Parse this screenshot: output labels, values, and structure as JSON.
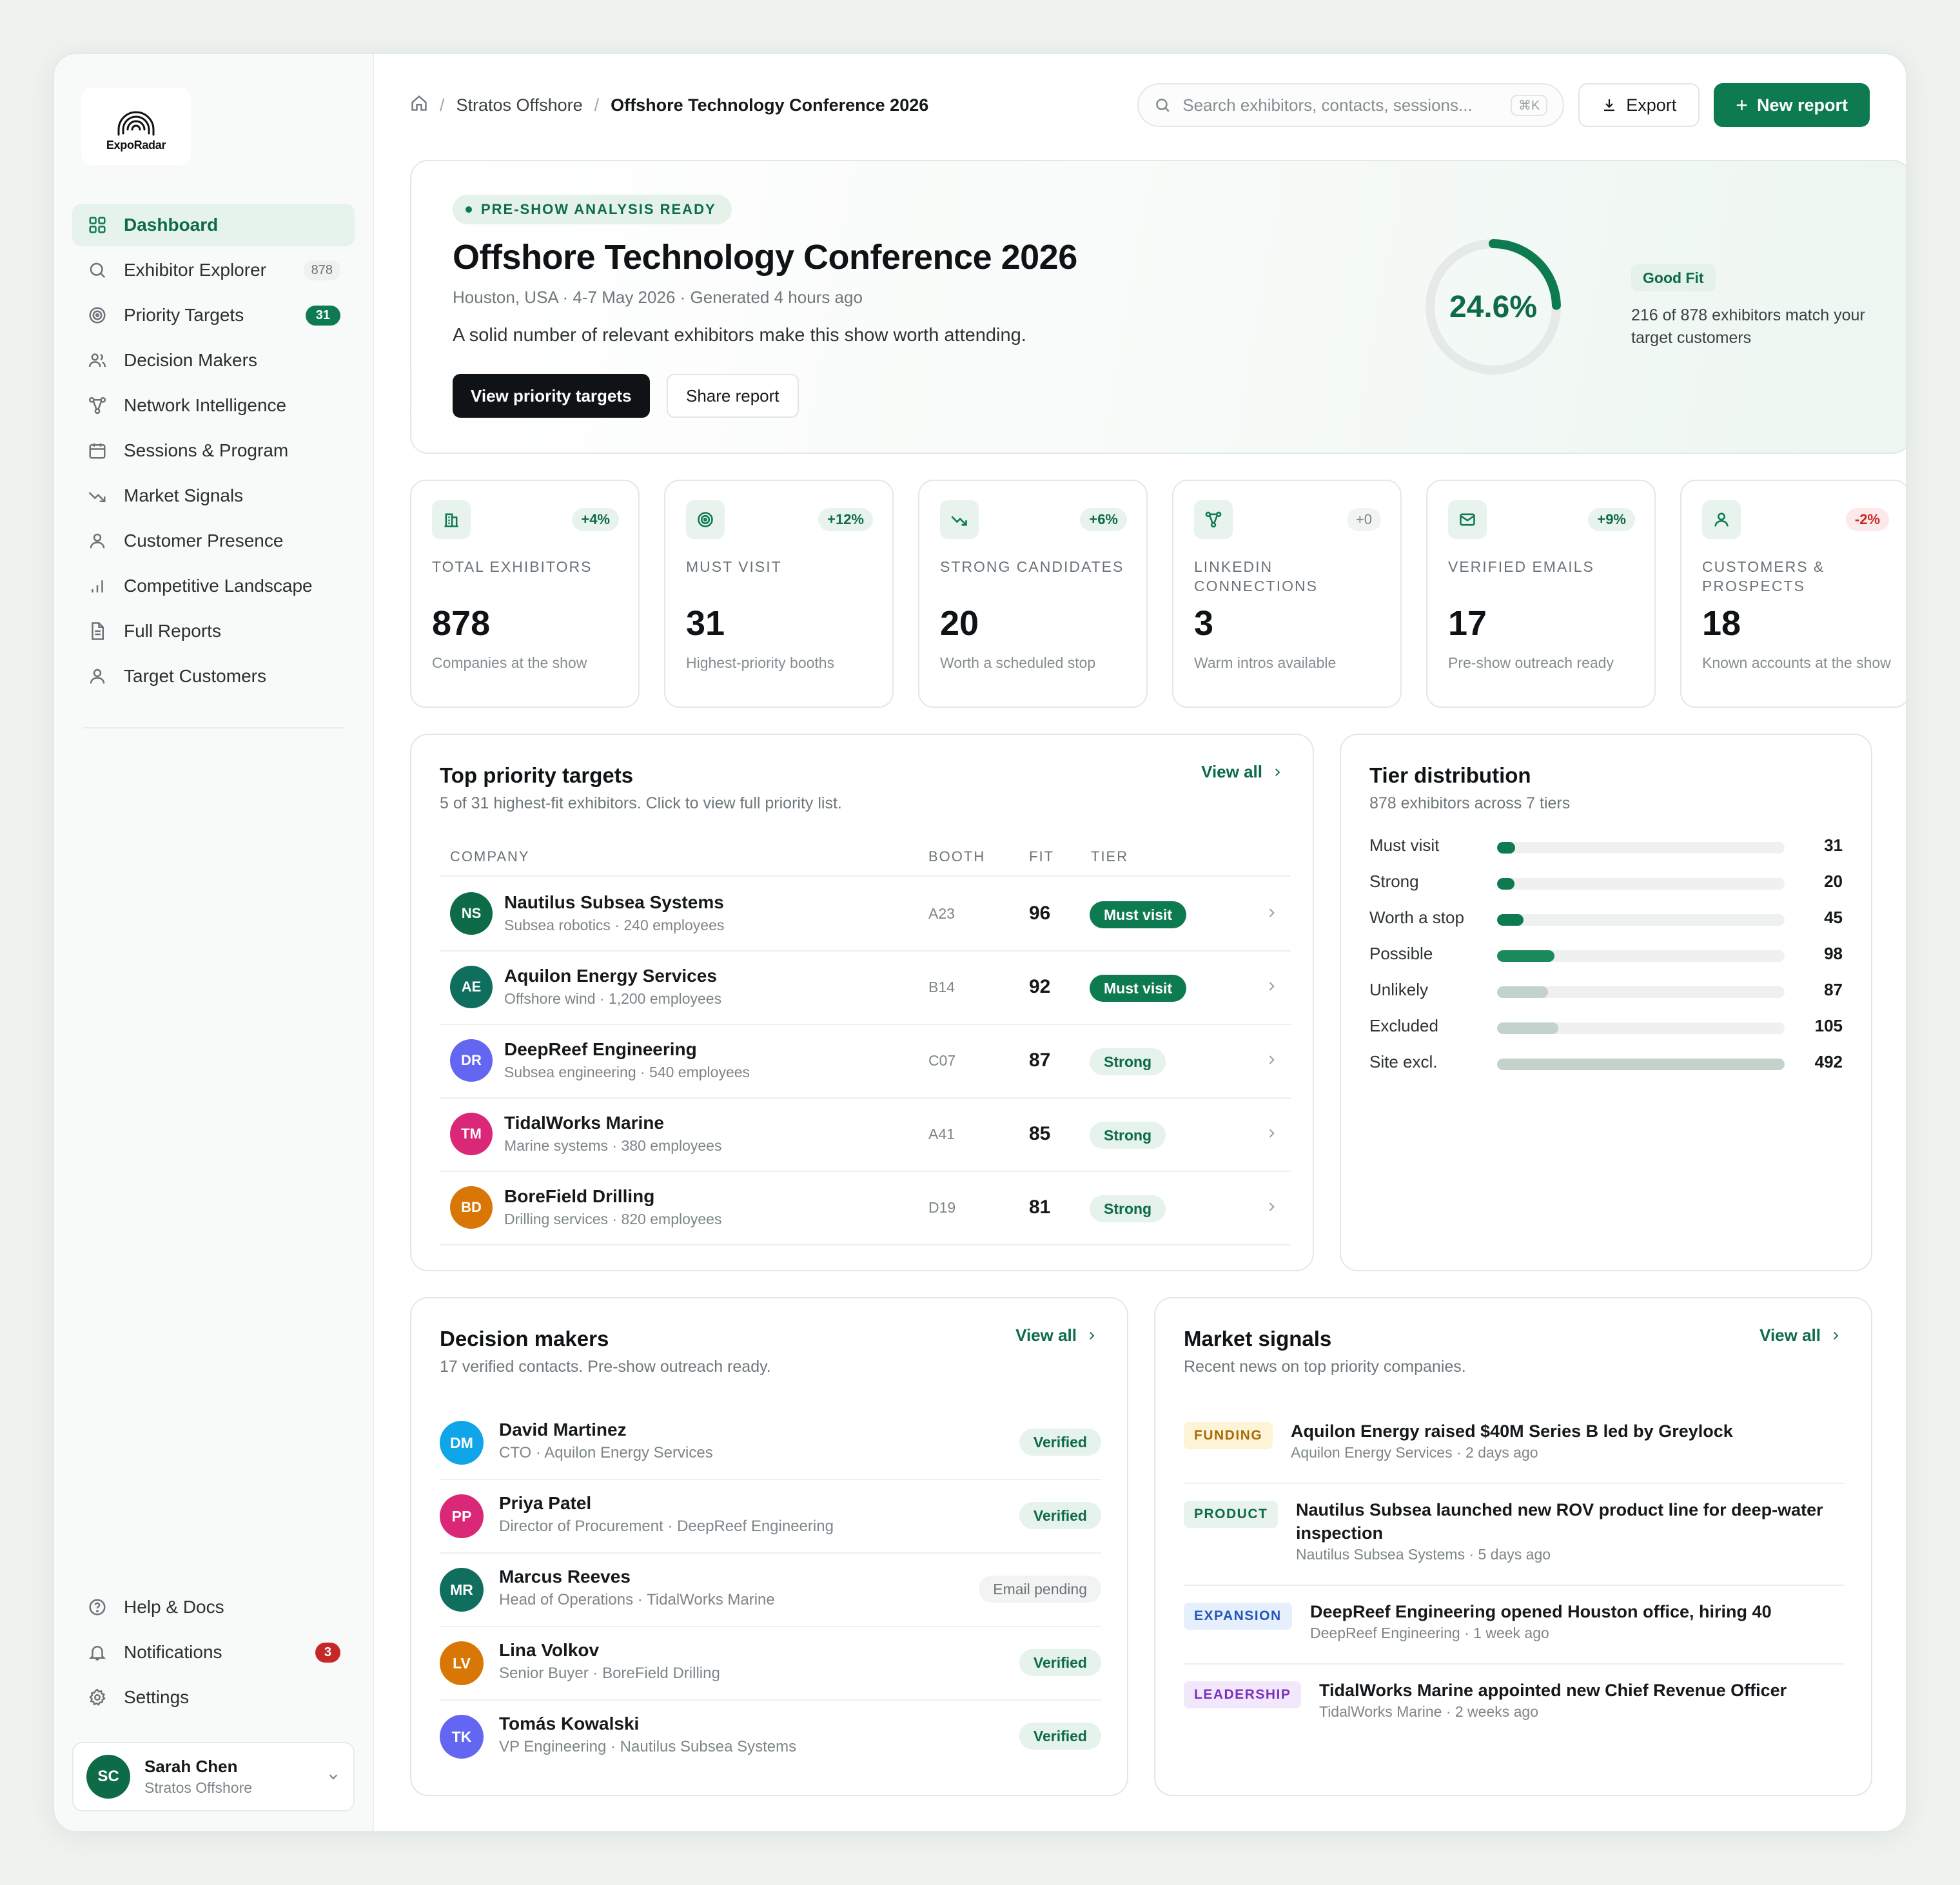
{
  "brand": {
    "name": "ExpoRadar"
  },
  "sidebar": {
    "items": [
      {
        "label": "Dashboard",
        "icon": "grid-icon",
        "active": true
      },
      {
        "label": "Exhibitor Explorer",
        "icon": "search-icon",
        "badge": "878"
      },
      {
        "label": "Priority Targets",
        "icon": "target-icon",
        "badge": "31"
      },
      {
        "label": "Decision Makers",
        "icon": "users-icon"
      },
      {
        "label": "Network Intelligence",
        "icon": "network-icon"
      },
      {
        "label": "Sessions & Program",
        "icon": "calendar-icon"
      },
      {
        "label": "Market Signals",
        "icon": "trend-icon"
      },
      {
        "label": "Customer Presence",
        "icon": "user-icon"
      },
      {
        "label": "Competitive Landscape",
        "icon": "bar-chart-icon"
      },
      {
        "label": "Full Reports",
        "icon": "document-icon"
      },
      {
        "label": "Target Customers",
        "icon": "user-icon"
      }
    ],
    "bottom": [
      {
        "label": "Help & Docs",
        "icon": "help-icon"
      },
      {
        "label": "Notifications",
        "icon": "bell-icon",
        "badge": "3"
      },
      {
        "label": "Settings",
        "icon": "gear-icon"
      }
    ],
    "user": {
      "initials": "SC",
      "name": "Sarah Chen",
      "org": "Stratos Offshore"
    }
  },
  "header": {
    "breadcrumb": [
      "Stratos Offshore",
      "Offshore Technology Conference 2026"
    ],
    "search_placeholder": "Search exhibitors, contacts, sessions...",
    "search_shortcut": "⌘K",
    "export_label": "Export",
    "new_report_label": "New report"
  },
  "hero": {
    "pill": "PRE-SHOW ANALYSIS READY",
    "title": "Offshore Technology Conference 2026",
    "subtitle": "Houston, USA · 4-7 May 2026 · Generated 4 hours ago",
    "description": "A solid number of relevant exhibitors make this show worth attending.",
    "primary_button": "View priority targets",
    "secondary_button": "Share report",
    "gauge_value": "24.6%",
    "gauge_fraction": 0.246,
    "fit_badge": "Good Fit",
    "fit_text": "216 of 878 exhibitors match your target customers"
  },
  "stats": [
    {
      "icon": "building-icon",
      "delta": "+4%",
      "tone": "pos",
      "label": "TOTAL EXHIBITORS",
      "value": "878",
      "desc": "Companies at the show"
    },
    {
      "icon": "target-icon",
      "delta": "+12%",
      "tone": "pos",
      "label": "MUST VISIT",
      "value": "31",
      "desc": "Highest-priority booths"
    },
    {
      "icon": "trend-icon",
      "delta": "+6%",
      "tone": "pos",
      "label": "STRONG CANDIDATES",
      "value": "20",
      "desc": "Worth a scheduled stop"
    },
    {
      "icon": "network-icon",
      "delta": "+0",
      "tone": "neutral",
      "label": "LINKEDIN CONNECTIONS",
      "value": "3",
      "desc": "Warm intros available"
    },
    {
      "icon": "mail-icon",
      "delta": "+9%",
      "tone": "pos",
      "label": "VERIFIED EMAILS",
      "value": "17",
      "desc": "Pre-show outreach ready"
    },
    {
      "icon": "user-icon",
      "delta": "-2%",
      "tone": "neg",
      "label": "CUSTOMERS & PROSPECTS",
      "value": "18",
      "desc": "Known accounts at the show"
    }
  ],
  "priority": {
    "title": "Top priority targets",
    "subtitle": "5 of 31 highest-fit exhibitors. Click to view full priority list.",
    "view_all": "View all",
    "columns": [
      "COMPANY",
      "BOOTH",
      "FIT",
      "TIER"
    ],
    "rows": [
      {
        "initials": "NS",
        "color": "#0e6b48",
        "name": "Nautilus Subsea Systems",
        "desc": "Subsea robotics · 240 employees",
        "booth": "A23",
        "fit": "96",
        "tier": "Must visit",
        "tier_kind": "must"
      },
      {
        "initials": "AE",
        "color": "#0f6e5e",
        "name": "Aquilon Energy Services",
        "desc": "Offshore wind · 1,200 employees",
        "booth": "B14",
        "fit": "92",
        "tier": "Must visit",
        "tier_kind": "must"
      },
      {
        "initials": "DR",
        "color": "#6366f1",
        "name": "DeepReef Engineering",
        "desc": "Subsea engineering · 540 employees",
        "booth": "C07",
        "fit": "87",
        "tier": "Strong",
        "tier_kind": "strong"
      },
      {
        "initials": "TM",
        "color": "#db2777",
        "name": "TidalWorks Marine",
        "desc": "Marine systems · 380 employees",
        "booth": "A41",
        "fit": "85",
        "tier": "Strong",
        "tier_kind": "strong"
      },
      {
        "initials": "BD",
        "color": "#d97706",
        "name": "BoreField Drilling",
        "desc": "Drilling services · 820 employees",
        "booth": "D19",
        "fit": "81",
        "tier": "Strong",
        "tier_kind": "strong"
      }
    ]
  },
  "tiers": {
    "title": "Tier distribution",
    "subtitle": "878 exhibitors across 7 tiers",
    "rows": [
      {
        "label": "Must visit",
        "value": "31",
        "fraction": 0.063,
        "color": "#0e7a50"
      },
      {
        "label": "Strong",
        "value": "20",
        "fraction": 0.041,
        "color": "#0e7a50"
      },
      {
        "label": "Worth a stop",
        "value": "45",
        "fraction": 0.091,
        "color": "#0e7a50"
      },
      {
        "label": "Possible",
        "value": "98",
        "fraction": 0.199,
        "color": "#1a8a5c"
      },
      {
        "label": "Unlikely",
        "value": "87",
        "fraction": 0.177,
        "color": "#c3d3cb"
      },
      {
        "label": "Excluded",
        "value": "105",
        "fraction": 0.213,
        "color": "#c3d3cb"
      },
      {
        "label": "Site excl.",
        "value": "492",
        "fraction": 1.0,
        "color": "#c3d3cb"
      }
    ]
  },
  "decision_makers": {
    "title": "Decision makers",
    "subtitle": "17 verified contacts. Pre-show outreach ready.",
    "view_all": "View all",
    "rows": [
      {
        "initials": "DM",
        "color": "#0ea5e9",
        "name": "David Martinez",
        "role": "CTO · Aquilon Energy Services",
        "status": "Verified",
        "status_kind": "verified"
      },
      {
        "initials": "PP",
        "color": "#db2777",
        "name": "Priya Patel",
        "role": "Director of Procurement · DeepReef Engineering",
        "status": "Verified",
        "status_kind": "verified"
      },
      {
        "initials": "MR",
        "color": "#0f6e5e",
        "name": "Marcus Reeves",
        "role": "Head of Operations · TidalWorks Marine",
        "status": "Email pending",
        "status_kind": "pending"
      },
      {
        "initials": "LV",
        "color": "#d97706",
        "name": "Lina Volkov",
        "role": "Senior Buyer · BoreField Drilling",
        "status": "Verified",
        "status_kind": "verified"
      },
      {
        "initials": "TK",
        "color": "#6366f1",
        "name": "Tomás Kowalski",
        "role": "VP Engineering · Nautilus Subsea Systems",
        "status": "Verified",
        "status_kind": "verified"
      }
    ]
  },
  "signals": {
    "title": "Market signals",
    "subtitle": "Recent news on top priority companies.",
    "view_all": "View all",
    "rows": [
      {
        "tag": "FUNDING",
        "kind": "funding",
        "headline": "Aquilon Energy raised $40M Series B led by Greylock",
        "meta": "Aquilon Energy Services · 2 days ago"
      },
      {
        "tag": "PRODUCT",
        "kind": "product",
        "headline": "Nautilus Subsea launched new ROV product line for deep-water inspection",
        "meta": "Nautilus Subsea Systems · 5 days ago"
      },
      {
        "tag": "EXPANSION",
        "kind": "expansion",
        "headline": "DeepReef Engineering opened Houston office, hiring 40",
        "meta": "DeepReef Engineering · 1 week ago"
      },
      {
        "tag": "LEADERSHIP",
        "kind": "leadership",
        "headline": "TidalWorks Marine appointed new Chief Revenue Officer",
        "meta": "TidalWorks Marine · 2 weeks ago"
      }
    ]
  }
}
